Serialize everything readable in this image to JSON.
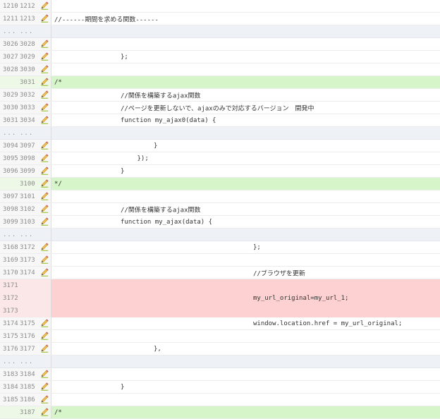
{
  "rows": [
    {
      "type": "ctx",
      "old": "1210",
      "new": "1212",
      "pencil": true,
      "text": "",
      "indent": 0
    },
    {
      "type": "ctx",
      "old": "1211",
      "new": "1213",
      "pencil": true,
      "text": "//------期間を求める関数------",
      "indent": 0
    },
    {
      "type": "ellipsis",
      "old": "...",
      "new": "...",
      "pencil": false,
      "text": "",
      "indent": 0
    },
    {
      "type": "ctx",
      "old": "3026",
      "new": "3028",
      "pencil": true,
      "text": "",
      "indent": 0
    },
    {
      "type": "ctx",
      "old": "3027",
      "new": "3029",
      "pencil": true,
      "text": "};",
      "indent": 4
    },
    {
      "type": "ctx",
      "old": "3028",
      "new": "3030",
      "pencil": true,
      "text": "",
      "indent": 0
    },
    {
      "type": "added",
      "old": "",
      "new": "3031",
      "pencil": true,
      "text": "/*",
      "indent": 0
    },
    {
      "type": "ctx",
      "old": "3029",
      "new": "3032",
      "pencil": true,
      "text": "//関係を構築するajax関数",
      "indent": 4
    },
    {
      "type": "ctx",
      "old": "3030",
      "new": "3033",
      "pencil": true,
      "text": "//ページを更新しないで、ajaxのみで対応するバージョン　開発中",
      "indent": 4
    },
    {
      "type": "ctx",
      "old": "3031",
      "new": "3034",
      "pencil": true,
      "text": "function my_ajax0(data) {",
      "indent": 4
    },
    {
      "type": "ellipsis",
      "old": "...",
      "new": "...",
      "pencil": false,
      "text": "",
      "indent": 0
    },
    {
      "type": "ctx",
      "old": "3094",
      "new": "3097",
      "pencil": true,
      "text": "}",
      "indent": 6
    },
    {
      "type": "ctx",
      "old": "3095",
      "new": "3098",
      "pencil": true,
      "text": "});",
      "indent": 5
    },
    {
      "type": "ctx",
      "old": "3096",
      "new": "3099",
      "pencil": true,
      "text": "}",
      "indent": 4
    },
    {
      "type": "added",
      "old": "",
      "new": "3100",
      "pencil": true,
      "text": "*/",
      "indent": 0
    },
    {
      "type": "ctx",
      "old": "3097",
      "new": "3101",
      "pencil": true,
      "text": "",
      "indent": 0
    },
    {
      "type": "ctx",
      "old": "3098",
      "new": "3102",
      "pencil": true,
      "text": "//関係を構築するajax関数",
      "indent": 4
    },
    {
      "type": "ctx",
      "old": "3099",
      "new": "3103",
      "pencil": true,
      "text": "function my_ajax(data) {",
      "indent": 4
    },
    {
      "type": "ellipsis",
      "old": "...",
      "new": "...",
      "pencil": false,
      "text": "",
      "indent": 0
    },
    {
      "type": "ctx",
      "old": "3168",
      "new": "3172",
      "pencil": true,
      "text": "};",
      "indent": 12
    },
    {
      "type": "ctx",
      "old": "3169",
      "new": "3173",
      "pencil": true,
      "text": "",
      "indent": 0
    },
    {
      "type": "ctx",
      "old": "3170",
      "new": "3174",
      "pencil": true,
      "text": "//ブラウザを更新",
      "indent": 12
    },
    {
      "type": "removed",
      "old": "3171",
      "new": "",
      "pencil": false,
      "text": "",
      "indent": 0
    },
    {
      "type": "removed",
      "old": "3172",
      "new": "",
      "pencil": false,
      "text": "my_url_original=my_url_1;",
      "indent": 12
    },
    {
      "type": "removed",
      "old": "3173",
      "new": "",
      "pencil": false,
      "text": "",
      "indent": 0
    },
    {
      "type": "ctx",
      "old": "3174",
      "new": "3175",
      "pencil": true,
      "text": "window.location.href = my_url_original;",
      "indent": 12
    },
    {
      "type": "ctx",
      "old": "3175",
      "new": "3176",
      "pencil": true,
      "text": "",
      "indent": 0
    },
    {
      "type": "ctx",
      "old": "3176",
      "new": "3177",
      "pencil": true,
      "text": "},",
      "indent": 6
    },
    {
      "type": "ellipsis",
      "old": "...",
      "new": "...",
      "pencil": false,
      "text": "",
      "indent": 0
    },
    {
      "type": "ctx",
      "old": "3183",
      "new": "3184",
      "pencil": true,
      "text": "",
      "indent": 0
    },
    {
      "type": "ctx",
      "old": "3184",
      "new": "3185",
      "pencil": true,
      "text": "}",
      "indent": 4
    },
    {
      "type": "ctx",
      "old": "3185",
      "new": "3186",
      "pencil": true,
      "text": "",
      "indent": 0
    },
    {
      "type": "added",
      "old": "",
      "new": "3187",
      "pencil": true,
      "text": "/*",
      "indent": 0
    }
  ],
  "colors": {
    "added": "#d6f5c8",
    "removed": "#fdd1d1",
    "ellipsis": "#eef2f6"
  },
  "icons": {
    "edit": "pencil-icon"
  }
}
